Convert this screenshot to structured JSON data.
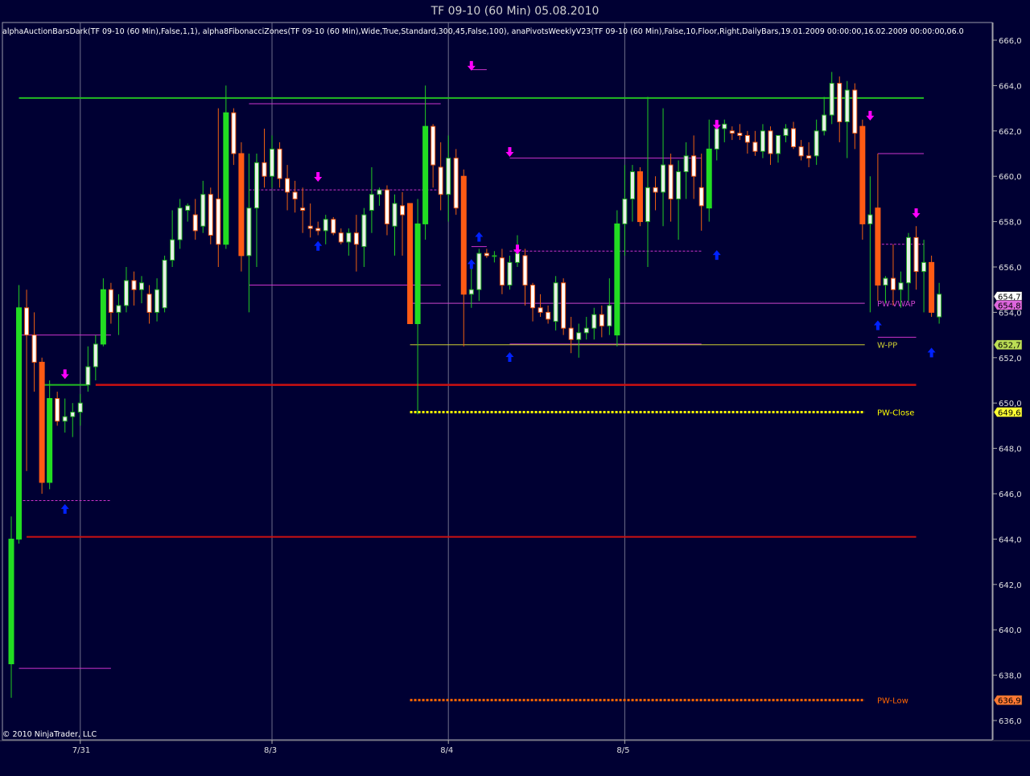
{
  "window": {
    "title": "TF 09-10 (60 Min)  05.08.2010"
  },
  "indicators_text": "alphaAuctionBarsDark(TF 09-10 (60 Min),False,1,1),  alpha8FibonacciZones(TF 09-10 (60 Min),Wide,True,Standard,300,45,False,100),  anaPivotsWeeklyV23(TF 09-10 (60 Min),False,10,Floor,Right,DailyBars,19.01.2009 00:00:00,16.02.2009 00:00:00,06.0",
  "copyright": "© 2010 NinjaTrader, LLC",
  "colors": {
    "background": "#000033",
    "up_candle": "#22dd22",
    "down_candle": "#ff5a14",
    "wick_up": "#22cc22",
    "wick_down": "#ee6010",
    "green_level": "#22bb22",
    "red_level": "#cc1111",
    "magenta": "#cc33cc",
    "yellow": "#ffff00",
    "orange": "#ff6600",
    "pink_arrow": "#ff00ff",
    "blue_arrow": "#0022ff",
    "grid": "#6e6e8a"
  },
  "chart_data": {
    "type": "candlestick",
    "title": "TF 09-10 (60 Min)  05.08.2010",
    "xlabel": "",
    "ylabel": "",
    "ylim": [
      635.5,
      666.4
    ],
    "y_ticks": [
      "666,0",
      "664,0",
      "662,0",
      "660,0",
      "658,0",
      "656,0",
      "654,0",
      "652,0",
      "650,0",
      "648,0",
      "646,0",
      "644,0",
      "642,0",
      "640,0",
      "638,0",
      "636,0"
    ],
    "y_tick_values": [
      666,
      664,
      662,
      660,
      658,
      656,
      654,
      652,
      650,
      648,
      646,
      644,
      642,
      640,
      638,
      636
    ],
    "x_ticks": [
      {
        "label": "7/31",
        "bar": 9
      },
      {
        "label": "8/3",
        "bar": 34
      },
      {
        "label": "8/4",
        "bar": 57
      },
      {
        "label": "8/5",
        "bar": 80
      }
    ],
    "grid": true,
    "candles": [
      {
        "o": 638.5,
        "h": 645.0,
        "l": 637.0,
        "c": 644.0
      },
      {
        "o": 644.0,
        "h": 655.2,
        "l": 643.8,
        "c": 654.2
      },
      {
        "o": 654.2,
        "h": 655.0,
        "l": 647.0,
        "c": 653.0
      },
      {
        "o": 653.0,
        "h": 654.0,
        "l": 650.5,
        "c": 651.8
      },
      {
        "o": 651.8,
        "h": 652.0,
        "l": 646.0,
        "c": 646.5
      },
      {
        "o": 646.5,
        "h": 651.0,
        "l": 646.2,
        "c": 650.2
      },
      {
        "o": 650.2,
        "h": 650.5,
        "l": 649.0,
        "c": 649.2
      },
      {
        "o": 649.2,
        "h": 650.2,
        "l": 648.7,
        "c": 649.4
      },
      {
        "o": 649.4,
        "h": 650.0,
        "l": 648.5,
        "c": 649.6
      },
      {
        "o": 649.6,
        "h": 650.4,
        "l": 649.0,
        "c": 650.0
      },
      {
        "o": 650.8,
        "h": 652.5,
        "l": 650.5,
        "c": 651.6
      },
      {
        "o": 651.6,
        "h": 653.0,
        "l": 651.0,
        "c": 652.6
      },
      {
        "o": 652.6,
        "h": 655.5,
        "l": 652.5,
        "c": 655.0
      },
      {
        "o": 655.0,
        "h": 655.3,
        "l": 653.5,
        "c": 654.0
      },
      {
        "o": 654.0,
        "h": 654.8,
        "l": 653.0,
        "c": 654.3
      },
      {
        "o": 654.3,
        "h": 656.0,
        "l": 654.0,
        "c": 655.4
      },
      {
        "o": 655.4,
        "h": 655.8,
        "l": 654.3,
        "c": 655.0
      },
      {
        "o": 655.0,
        "h": 655.6,
        "l": 654.4,
        "c": 655.3
      },
      {
        "o": 654.8,
        "h": 655.2,
        "l": 653.5,
        "c": 654.0
      },
      {
        "o": 654.0,
        "h": 655.5,
        "l": 653.6,
        "c": 655.0
      },
      {
        "o": 654.2,
        "h": 656.5,
        "l": 654.0,
        "c": 656.3
      },
      {
        "o": 656.3,
        "h": 658.5,
        "l": 656.0,
        "c": 657.2
      },
      {
        "o": 657.2,
        "h": 659.0,
        "l": 656.8,
        "c": 658.6
      },
      {
        "o": 658.5,
        "h": 658.8,
        "l": 658.0,
        "c": 658.7
      },
      {
        "o": 658.3,
        "h": 659.0,
        "l": 657.2,
        "c": 657.6
      },
      {
        "o": 657.8,
        "h": 659.8,
        "l": 657.5,
        "c": 659.2
      },
      {
        "o": 659.2,
        "h": 659.5,
        "l": 657.0,
        "c": 657.4
      },
      {
        "o": 659.0,
        "h": 663.0,
        "l": 656.0,
        "c": 657.0
      },
      {
        "o": 657.0,
        "h": 664.0,
        "l": 656.8,
        "c": 662.8
      },
      {
        "o": 662.8,
        "h": 663.0,
        "l": 660.5,
        "c": 661.0
      },
      {
        "o": 661.0,
        "h": 661.5,
        "l": 655.8,
        "c": 656.5
      },
      {
        "o": 656.5,
        "h": 661.0,
        "l": 654.0,
        "c": 658.6
      },
      {
        "o": 658.6,
        "h": 661.0,
        "l": 656.0,
        "c": 660.6
      },
      {
        "o": 660.6,
        "h": 662.1,
        "l": 659.5,
        "c": 660.0
      },
      {
        "o": 660.0,
        "h": 661.8,
        "l": 659.5,
        "c": 661.2
      },
      {
        "o": 661.2,
        "h": 661.5,
        "l": 659.5,
        "c": 659.9
      },
      {
        "o": 659.9,
        "h": 660.5,
        "l": 658.5,
        "c": 659.3
      },
      {
        "o": 659.3,
        "h": 659.8,
        "l": 658.4,
        "c": 659.0
      },
      {
        "o": 658.6,
        "h": 659.5,
        "l": 657.5,
        "c": 658.5
      },
      {
        "o": 657.8,
        "h": 658.8,
        "l": 657.3,
        "c": 657.7
      },
      {
        "o": 657.7,
        "h": 658.0,
        "l": 657.4,
        "c": 657.6
      },
      {
        "o": 657.6,
        "h": 658.3,
        "l": 657.0,
        "c": 658.1
      },
      {
        "o": 658.1,
        "h": 658.2,
        "l": 657.4,
        "c": 657.5
      },
      {
        "o": 657.5,
        "h": 657.7,
        "l": 657.0,
        "c": 657.1
      },
      {
        "o": 657.1,
        "h": 657.7,
        "l": 656.5,
        "c": 657.5
      },
      {
        "o": 657.5,
        "h": 658.3,
        "l": 655.8,
        "c": 657.0
      },
      {
        "o": 656.9,
        "h": 658.6,
        "l": 656.0,
        "c": 658.3
      },
      {
        "o": 658.5,
        "h": 660.4,
        "l": 657.5,
        "c": 659.2
      },
      {
        "o": 659.2,
        "h": 659.5,
        "l": 658.7,
        "c": 659.4
      },
      {
        "o": 659.4,
        "h": 659.6,
        "l": 657.4,
        "c": 657.9
      },
      {
        "o": 657.8,
        "h": 659.2,
        "l": 656.5,
        "c": 658.8
      },
      {
        "o": 658.7,
        "h": 659.3,
        "l": 656.5,
        "c": 658.3
      },
      {
        "o": 658.8,
        "h": 658.8,
        "l": 653.5,
        "c": 653.5
      },
      {
        "o": 653.5,
        "h": 659.0,
        "l": 649.5,
        "c": 657.9
      },
      {
        "o": 657.9,
        "h": 664.0,
        "l": 657.2,
        "c": 662.2
      },
      {
        "o": 662.2,
        "h": 662.3,
        "l": 659.5,
        "c": 660.5
      },
      {
        "o": 660.4,
        "h": 661.5,
        "l": 658.5,
        "c": 659.2
      },
      {
        "o": 659.2,
        "h": 661.8,
        "l": 658.0,
        "c": 660.8
      },
      {
        "o": 660.8,
        "h": 661.2,
        "l": 658.3,
        "c": 658.6
      },
      {
        "o": 660.0,
        "h": 660.3,
        "l": 652.5,
        "c": 654.8
      },
      {
        "o": 654.8,
        "h": 656.2,
        "l": 654.2,
        "c": 655.0
      },
      {
        "o": 655.0,
        "h": 656.8,
        "l": 654.5,
        "c": 656.6
      },
      {
        "o": 656.6,
        "h": 656.8,
        "l": 656.4,
        "c": 656.5
      },
      {
        "o": 656.5,
        "h": 656.7,
        "l": 656.2,
        "c": 656.5
      },
      {
        "o": 656.4,
        "h": 656.8,
        "l": 654.8,
        "c": 655.2
      },
      {
        "o": 655.2,
        "h": 656.5,
        "l": 655.0,
        "c": 656.2
      },
      {
        "o": 656.2,
        "h": 657.4,
        "l": 656.0,
        "c": 656.6
      },
      {
        "o": 656.5,
        "h": 656.8,
        "l": 654.3,
        "c": 655.2
      },
      {
        "o": 655.2,
        "h": 655.3,
        "l": 653.6,
        "c": 654.2
      },
      {
        "o": 654.2,
        "h": 654.8,
        "l": 653.8,
        "c": 654.0
      },
      {
        "o": 654.0,
        "h": 654.3,
        "l": 653.5,
        "c": 653.7
      },
      {
        "o": 653.6,
        "h": 655.6,
        "l": 653.2,
        "c": 655.3
      },
      {
        "o": 655.3,
        "h": 655.5,
        "l": 653.0,
        "c": 653.3
      },
      {
        "o": 653.3,
        "h": 653.8,
        "l": 652.2,
        "c": 652.8
      },
      {
        "o": 652.8,
        "h": 653.5,
        "l": 652.0,
        "c": 653.1
      },
      {
        "o": 653.1,
        "h": 653.8,
        "l": 652.8,
        "c": 653.3
      },
      {
        "o": 653.3,
        "h": 654.2,
        "l": 652.8,
        "c": 653.9
      },
      {
        "o": 653.9,
        "h": 654.3,
        "l": 652.9,
        "c": 653.4
      },
      {
        "o": 653.4,
        "h": 655.5,
        "l": 653.0,
        "c": 654.3
      },
      {
        "o": 653.0,
        "h": 658.5,
        "l": 652.5,
        "c": 657.9
      },
      {
        "o": 657.9,
        "h": 660.5,
        "l": 656.5,
        "c": 659.0
      },
      {
        "o": 659.0,
        "h": 660.5,
        "l": 658.0,
        "c": 660.2
      },
      {
        "o": 660.2,
        "h": 660.4,
        "l": 657.8,
        "c": 658.0
      },
      {
        "o": 658.0,
        "h": 663.5,
        "l": 656.0,
        "c": 659.5
      },
      {
        "o": 659.5,
        "h": 660.0,
        "l": 658.5,
        "c": 659.3
      },
      {
        "o": 659.3,
        "h": 663.0,
        "l": 657.8,
        "c": 660.5
      },
      {
        "o": 660.5,
        "h": 661.0,
        "l": 658.0,
        "c": 659.0
      },
      {
        "o": 659.0,
        "h": 660.7,
        "l": 657.2,
        "c": 660.2
      },
      {
        "o": 660.2,
        "h": 661.5,
        "l": 659.0,
        "c": 660.9
      },
      {
        "o": 660.9,
        "h": 661.8,
        "l": 659.0,
        "c": 660.0
      },
      {
        "o": 659.5,
        "h": 661.0,
        "l": 657.6,
        "c": 658.7
      },
      {
        "o": 658.6,
        "h": 662.5,
        "l": 658.0,
        "c": 661.2
      },
      {
        "o": 661.2,
        "h": 662.2,
        "l": 660.7,
        "c": 662.1
      },
      {
        "o": 662.1,
        "h": 662.5,
        "l": 661.5,
        "c": 662.3
      },
      {
        "o": 662.0,
        "h": 662.2,
        "l": 661.6,
        "c": 661.9
      },
      {
        "o": 661.9,
        "h": 662.3,
        "l": 661.6,
        "c": 661.8
      },
      {
        "o": 661.8,
        "h": 662.0,
        "l": 661.0,
        "c": 661.5
      },
      {
        "o": 661.5,
        "h": 662.0,
        "l": 660.9,
        "c": 661.1
      },
      {
        "o": 661.1,
        "h": 662.3,
        "l": 660.8,
        "c": 662.0
      },
      {
        "o": 662.0,
        "h": 662.2,
        "l": 660.5,
        "c": 661.0
      },
      {
        "o": 661.0,
        "h": 661.6,
        "l": 660.6,
        "c": 661.8
      },
      {
        "o": 661.8,
        "h": 662.3,
        "l": 661.5,
        "c": 662.1
      },
      {
        "o": 662.1,
        "h": 662.4,
        "l": 661.2,
        "c": 661.3
      },
      {
        "o": 661.3,
        "h": 661.6,
        "l": 660.7,
        "c": 660.9
      },
      {
        "o": 660.9,
        "h": 661.5,
        "l": 660.4,
        "c": 660.8
      },
      {
        "o": 660.9,
        "h": 662.5,
        "l": 660.5,
        "c": 662.0
      },
      {
        "o": 662.0,
        "h": 663.5,
        "l": 661.8,
        "c": 662.7
      },
      {
        "o": 662.7,
        "h": 664.6,
        "l": 662.3,
        "c": 664.1
      },
      {
        "o": 664.1,
        "h": 664.4,
        "l": 661.5,
        "c": 662.4
      },
      {
        "o": 662.4,
        "h": 664.2,
        "l": 660.8,
        "c": 663.8
      },
      {
        "o": 663.8,
        "h": 664.1,
        "l": 661.2,
        "c": 661.9
      },
      {
        "o": 662.2,
        "h": 662.5,
        "l": 657.2,
        "c": 657.9
      },
      {
        "o": 657.9,
        "h": 660.0,
        "l": 654.0,
        "c": 658.3
      },
      {
        "o": 658.6,
        "h": 661.0,
        "l": 654.5,
        "c": 655.2
      },
      {
        "o": 655.2,
        "h": 655.6,
        "l": 654.4,
        "c": 655.5
      },
      {
        "o": 655.5,
        "h": 657.0,
        "l": 654.3,
        "c": 655.0
      },
      {
        "o": 655.0,
        "h": 655.8,
        "l": 654.2,
        "c": 655.3
      },
      {
        "o": 655.3,
        "h": 657.5,
        "l": 654.5,
        "c": 657.3
      },
      {
        "o": 657.3,
        "h": 657.8,
        "l": 655.0,
        "c": 655.8
      },
      {
        "o": 655.8,
        "h": 657.2,
        "l": 654.0,
        "c": 656.2
      },
      {
        "o": 656.2,
        "h": 656.5,
        "l": 653.8,
        "c": 654.0
      },
      {
        "o": 653.8,
        "h": 655.3,
        "l": 653.5,
        "c": 654.8
      }
    ],
    "levels": [
      {
        "name": "PW-VWAP",
        "label": "PW-VWAP",
        "value": 654.4,
        "tag": "654,8",
        "color": "#cc44cc",
        "style": "solid"
      },
      {
        "name": "W-PP",
        "label": "W-PP",
        "value": 652.57,
        "tag": "652,7",
        "color": "#cccc33",
        "style": "solid"
      },
      {
        "name": "PW-Close",
        "label": "PW-Close",
        "value": 649.6,
        "tag": "649,6",
        "color": "#ffff00",
        "style": "dotted"
      },
      {
        "name": "PW-Low",
        "label": "PW-Low",
        "value": 636.9,
        "tag": "636,9",
        "color": "#ff6600",
        "style": "dotted"
      }
    ],
    "last_price_tag": {
      "value": 654.7,
      "label": "654,7"
    },
    "horizontal_lines": [
      {
        "value": 663.45,
        "start_bar": 1,
        "end_bar": 119,
        "color": "#22bb22",
        "width": 2
      },
      {
        "value": 650.8,
        "start_bar": 11,
        "end_bar": 118,
        "color": "#cc1111",
        "width": 2.5
      },
      {
        "value": 644.1,
        "start_bar": 2,
        "end_bar": 118,
        "color": "#cc1111",
        "width": 2
      },
      {
        "value": 650.8,
        "start_bar": 4,
        "end_bar": 10,
        "color": "#22bb22",
        "width": 2
      },
      {
        "value": 653.0,
        "start_bar": 1,
        "end_bar": 13,
        "color": "#cc33cc",
        "width": 1
      },
      {
        "value": 645.7,
        "start_bar": 1,
        "end_bar": 13,
        "color": "#cc33cc",
        "width": 1,
        "dash": true
      },
      {
        "value": 638.3,
        "start_bar": 1,
        "end_bar": 13,
        "color": "#cc33cc",
        "width": 1
      },
      {
        "value": 663.2,
        "start_bar": 31,
        "end_bar": 56,
        "color": "#cc33cc",
        "width": 1
      },
      {
        "value": 659.4,
        "start_bar": 31,
        "end_bar": 56,
        "color": "#cc33cc",
        "width": 1,
        "dash": true
      },
      {
        "value": 655.2,
        "start_bar": 31,
        "end_bar": 56,
        "color": "#cc33cc",
        "width": 1
      },
      {
        "value": 664.7,
        "start_bar": 60,
        "end_bar": 62,
        "color": "#cc33cc",
        "width": 1
      },
      {
        "value": 660.8,
        "start_bar": 65,
        "end_bar": 90,
        "color": "#cc33cc",
        "width": 1
      },
      {
        "value": 656.7,
        "start_bar": 65,
        "end_bar": 90,
        "color": "#cc33cc",
        "width": 1,
        "dash": true
      },
      {
        "value": 652.6,
        "start_bar": 65,
        "end_bar": 90,
        "color": "#cc33cc",
        "width": 1
      },
      {
        "value": 656.9,
        "start_bar": 60,
        "end_bar": 62,
        "color": "#cc33cc",
        "width": 1
      },
      {
        "value": 661.0,
        "start_bar": 113,
        "end_bar": 119,
        "color": "#cc33cc",
        "width": 1
      },
      {
        "value": 657.0,
        "start_bar": 113,
        "end_bar": 119,
        "color": "#cc33cc",
        "width": 1,
        "dash": true
      },
      {
        "value": 652.9,
        "start_bar": 113,
        "end_bar": 118,
        "color": "#cc33cc",
        "width": 1
      }
    ],
    "signals": [
      {
        "bar": 7,
        "value": 651.2,
        "type": "down-arrow"
      },
      {
        "bar": 7,
        "value": 645.4,
        "type": "up-arrow"
      },
      {
        "bar": 40,
        "value": 659.9,
        "type": "down-arrow"
      },
      {
        "bar": 40,
        "value": 657.0,
        "type": "up-arrow"
      },
      {
        "bar": 60,
        "value": 664.8,
        "type": "down-arrow"
      },
      {
        "bar": 61,
        "value": 657.4,
        "type": "up-arrow"
      },
      {
        "bar": 60,
        "value": 656.2,
        "type": "up-arrow"
      },
      {
        "bar": 65,
        "value": 661.0,
        "type": "down-arrow"
      },
      {
        "bar": 66,
        "value": 656.7,
        "type": "down-arrow"
      },
      {
        "bar": 65,
        "value": 652.1,
        "type": "up-arrow"
      },
      {
        "bar": 92,
        "value": 662.2,
        "type": "down-arrow"
      },
      {
        "bar": 92,
        "value": 656.6,
        "type": "up-arrow"
      },
      {
        "bar": 112,
        "value": 662.6,
        "type": "down-arrow"
      },
      {
        "bar": 113,
        "value": 653.5,
        "type": "up-arrow"
      },
      {
        "bar": 118,
        "value": 658.3,
        "type": "down-arrow"
      },
      {
        "bar": 120,
        "value": 652.3,
        "type": "up-arrow"
      }
    ]
  }
}
